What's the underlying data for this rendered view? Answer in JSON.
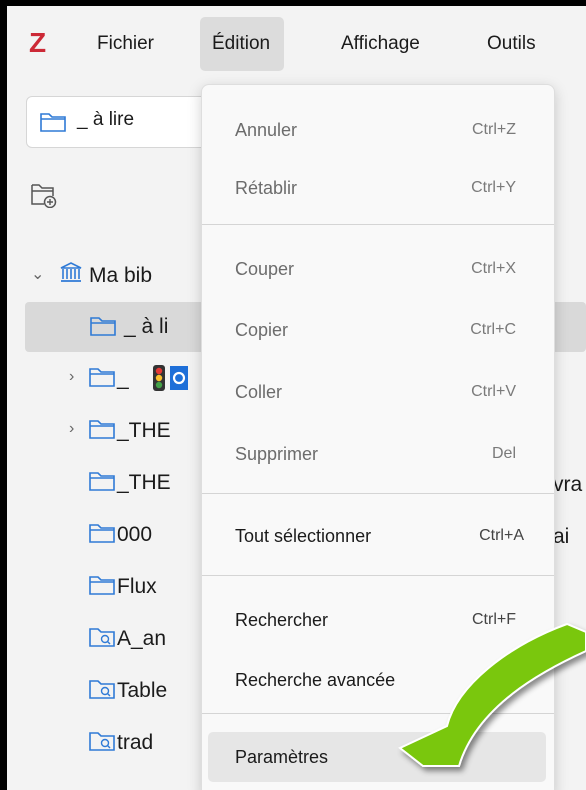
{
  "app": {
    "logo_letter": "Z",
    "logo_color": "#cc2936"
  },
  "menubar": {
    "items": [
      {
        "label": "Fichier"
      },
      {
        "label": "Édition"
      },
      {
        "label": "Affichage"
      },
      {
        "label": "Outils"
      }
    ]
  },
  "toolbar": {
    "collection_selector": "_ à lire"
  },
  "tree": {
    "library": "Ma bib",
    "rows": [
      {
        "label": "_ à li"
      },
      {
        "label": "_"
      },
      {
        "label": "_THE"
      },
      {
        "label": "_THE"
      },
      {
        "label": "000"
      },
      {
        "label": "Flux"
      },
      {
        "label": "A_an"
      },
      {
        "label": "Table"
      },
      {
        "label": "trad"
      }
    ],
    "peek_text": {
      "vra": "vra",
      "ai": "ai"
    }
  },
  "edit_menu": {
    "items": [
      {
        "label": "Annuler",
        "shortcut": "Ctrl+Z"
      },
      {
        "label": "Rétablir",
        "shortcut": "Ctrl+Y"
      },
      {
        "label": "Couper",
        "shortcut": "Ctrl+X"
      },
      {
        "label": "Copier",
        "shortcut": "Ctrl+C"
      },
      {
        "label": "Coller",
        "shortcut": "Ctrl+V"
      },
      {
        "label": "Supprimer",
        "shortcut": "Del"
      },
      {
        "label": "Tout sélectionner",
        "shortcut": "Ctrl+A"
      },
      {
        "label": "Rechercher",
        "shortcut": "Ctrl+F"
      },
      {
        "label": "Recherche avancée",
        "shortcut": ""
      },
      {
        "label": "Paramètres",
        "shortcut": ""
      }
    ]
  },
  "colors": {
    "accent_arrow": "#7ac70c",
    "selection": "#d9d9d9",
    "folder_icon": "#2f7ad6"
  }
}
